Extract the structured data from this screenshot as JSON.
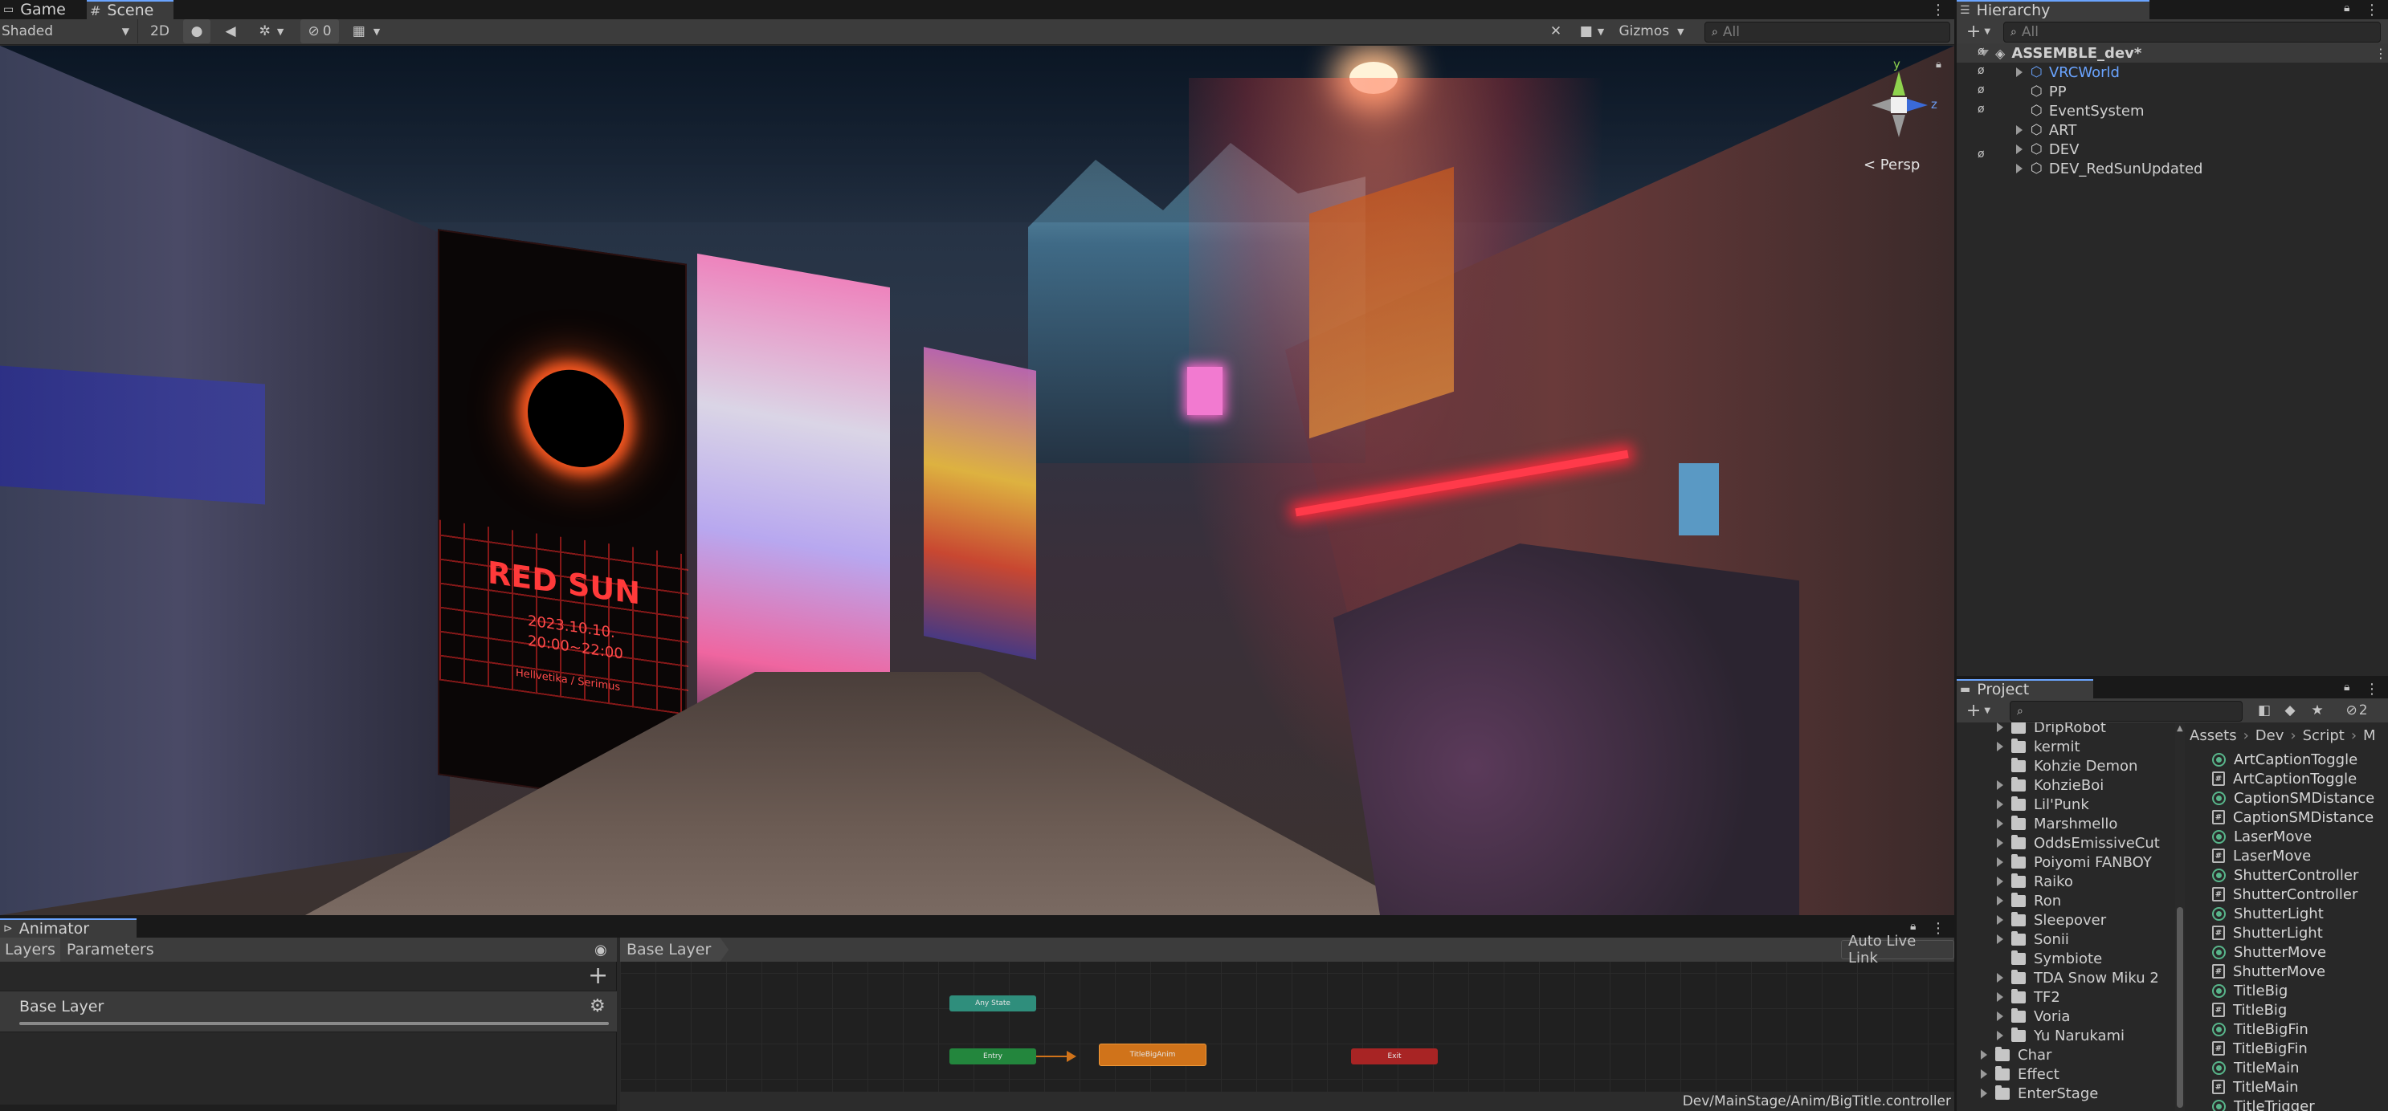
{
  "scene_panel": {
    "tabs": [
      "Game",
      "Scene"
    ],
    "shading_mode": "Shaded",
    "mode_2d": "2D",
    "hidden_count": "0",
    "gizmos_label": "Gizmos",
    "search_placeholder": "All",
    "persp_label": "< Persp",
    "gizmo_axes": {
      "y": "y",
      "z": "z"
    },
    "poster_text": {
      "title": "RED SUN",
      "date": "2023.10.10.",
      "time": "20:00~22:00",
      "venue": "Hellvetika / Serimus"
    }
  },
  "hierarchy": {
    "title": "Hierarchy",
    "search_placeholder": "All",
    "scene_name": "ASSEMBLE_dev*",
    "items": [
      {
        "label": "VRCWorld",
        "expandable": true,
        "color": "#6aa4ff"
      },
      {
        "label": "PP",
        "expandable": false,
        "color": "#d0d0d0"
      },
      {
        "label": "EventSystem",
        "expandable": false,
        "color": "#d0d0d0"
      },
      {
        "label": "ART",
        "expandable": true,
        "color": "#d0d0d0"
      },
      {
        "label": "DEV",
        "expandable": true,
        "color": "#d0d0d0"
      },
      {
        "label": "DEV_RedSunUpdated",
        "expandable": true,
        "color": "#d0d0d0"
      }
    ]
  },
  "project": {
    "title": "Project",
    "hidden_count": "2",
    "breadcrumb": [
      "Assets",
      "Dev",
      "Script",
      "M"
    ],
    "folders": [
      {
        "label": "DripRobot",
        "expandable": true,
        "indent": 1
      },
      {
        "label": "kermit",
        "expandable": true,
        "indent": 1
      },
      {
        "label": "Kohzie Demon",
        "expandable": false,
        "indent": 1
      },
      {
        "label": "KohzieBoi",
        "expandable": true,
        "indent": 1
      },
      {
        "label": "Lil'Punk",
        "expandable": true,
        "indent": 1
      },
      {
        "label": "Marshmello",
        "expandable": true,
        "indent": 1
      },
      {
        "label": "OddsEmissiveCut",
        "expandable": true,
        "indent": 1
      },
      {
        "label": "Poiyomi FANBOY",
        "expandable": true,
        "indent": 1
      },
      {
        "label": "Raiko",
        "expandable": true,
        "indent": 1
      },
      {
        "label": "Ron",
        "expandable": true,
        "indent": 1
      },
      {
        "label": "Sleepover",
        "expandable": true,
        "indent": 1
      },
      {
        "label": "Sonii",
        "expandable": true,
        "indent": 1
      },
      {
        "label": "Symbiote",
        "expandable": false,
        "indent": 1
      },
      {
        "label": "TDA Snow Miku 2",
        "expandable": true,
        "indent": 1
      },
      {
        "label": "TF2",
        "expandable": true,
        "indent": 1
      },
      {
        "label": "Voria",
        "expandable": true,
        "indent": 1
      },
      {
        "label": "Yu Narukami",
        "expandable": true,
        "indent": 1
      },
      {
        "label": "Char",
        "expandable": true,
        "indent": 0
      },
      {
        "label": "Effect",
        "expandable": true,
        "indent": 0
      },
      {
        "label": "EnterStage",
        "expandable": true,
        "indent": 0
      }
    ],
    "assets": [
      {
        "label": "ArtCaptionToggle",
        "kind": "controller"
      },
      {
        "label": "ArtCaptionToggle",
        "kind": "script"
      },
      {
        "label": "CaptionSMDistance",
        "kind": "controller"
      },
      {
        "label": "CaptionSMDistance",
        "kind": "script"
      },
      {
        "label": "LaserMove",
        "kind": "controller"
      },
      {
        "label": "LaserMove",
        "kind": "script"
      },
      {
        "label": "ShutterController",
        "kind": "controller"
      },
      {
        "label": "ShutterController",
        "kind": "script"
      },
      {
        "label": "ShutterLight",
        "kind": "controller"
      },
      {
        "label": "ShutterLight",
        "kind": "script"
      },
      {
        "label": "ShutterMove",
        "kind": "controller"
      },
      {
        "label": "ShutterMove",
        "kind": "script"
      },
      {
        "label": "TitleBig",
        "kind": "controller"
      },
      {
        "label": "TitleBig",
        "kind": "script"
      },
      {
        "label": "TitleBigFin",
        "kind": "controller"
      },
      {
        "label": "TitleBigFin",
        "kind": "script"
      },
      {
        "label": "TitleMain",
        "kind": "controller"
      },
      {
        "label": "TitleMain",
        "kind": "script"
      },
      {
        "label": "TitleTrigger",
        "kind": "controller"
      }
    ]
  },
  "animator": {
    "title": "Animator",
    "tabs": [
      "Layers",
      "Parameters"
    ],
    "layer_name": "Base Layer",
    "breadcrumb": "Base Layer",
    "auto_live_link": "Auto Live Link",
    "controller_path": "Dev/MainStage/Anim/BigTitle.controller",
    "states": {
      "any": "Any State",
      "entry": "Entry",
      "default": "TitleBigAnim",
      "exit": "Exit"
    }
  },
  "colors": {
    "panel_bg": "#282828",
    "toolbar_bg": "#3c3c3c",
    "tab_bg": "#3c3c3c",
    "accent_blue": "#6aa4ff",
    "state_any": "#2f8e7c",
    "state_entry": "#23863d",
    "state_default": "#d0731a",
    "state_exit": "#a82424"
  }
}
